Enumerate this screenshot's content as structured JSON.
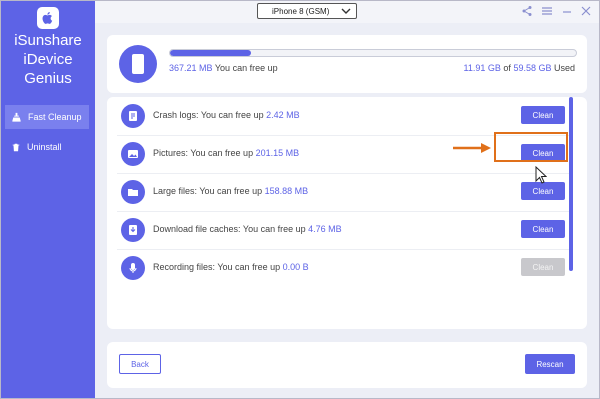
{
  "app": {
    "name_lines": [
      "iSunshare",
      "iDevice",
      "Genius"
    ],
    "logo_icon": "apple-icon"
  },
  "colors": {
    "accent": "#5d63e6",
    "highlight": "#e0701a",
    "disabled": "#c8c8cc"
  },
  "sidebar": {
    "items": [
      {
        "label": "Fast Cleanup",
        "icon": "broom-icon",
        "active": true
      },
      {
        "label": "Uninstall",
        "icon": "trash-icon",
        "active": false
      }
    ]
  },
  "titlebar": {
    "device": "iPhone 8 (GSM)",
    "icons": [
      "share-icon",
      "menu-icon",
      "minimize-icon",
      "close-icon"
    ]
  },
  "storage": {
    "free_amount": "367.21 MB",
    "free_suffix": "You can free up",
    "used": "11.91 GB",
    "of_word": "of",
    "total": "59.58 GB",
    "used_word": "Used",
    "progress_fraction": 0.2
  },
  "items": [
    {
      "label": "Crash logs: You can free up",
      "amount": "2.42 MB",
      "button": "Clean",
      "enabled": true,
      "icon": "crash-log-icon"
    },
    {
      "label": "Pictures: You can free up",
      "amount": "201.15 MB",
      "button": "Clean",
      "enabled": true,
      "icon": "picture-icon"
    },
    {
      "label": "Large files: You can free up",
      "amount": "158.88 MB",
      "button": "Clean",
      "enabled": true,
      "icon": "folder-icon"
    },
    {
      "label": "Download file caches: You can free up",
      "amount": "4.76 MB",
      "button": "Clean",
      "enabled": true,
      "icon": "download-icon"
    },
    {
      "label": "Recording files: You can free up",
      "amount": "0.00 B",
      "button": "Clean",
      "enabled": false,
      "icon": "microphone-icon"
    }
  ],
  "footer": {
    "back_label": "Back",
    "rescan_label": "Rescan"
  }
}
